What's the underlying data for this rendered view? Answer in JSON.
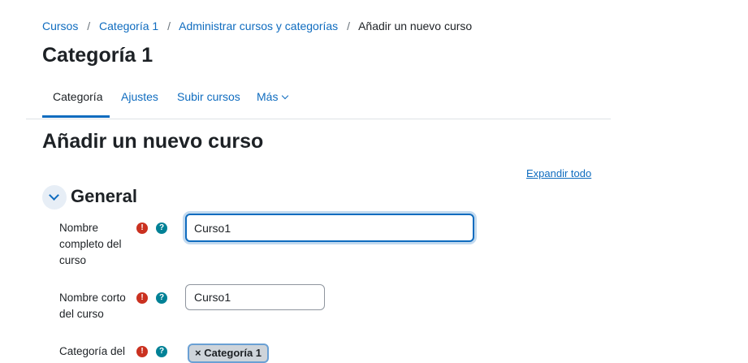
{
  "breadcrumb": {
    "items": [
      "Cursos",
      "Categoría 1",
      "Administrar cursos y categorías"
    ],
    "current": "Añadir un nuevo curso",
    "separator": "/"
  },
  "page_title": "Categoría 1",
  "tabs": [
    {
      "label": "Categoría",
      "active": true
    },
    {
      "label": "Ajustes",
      "active": false
    },
    {
      "label": "Subir cursos",
      "active": false
    },
    {
      "label": "Más",
      "active": false
    }
  ],
  "form_title": "Añadir un nuevo curso",
  "expand_all_label": "Expandir todo",
  "section": {
    "title": "General",
    "icon": "chevron-down-icon"
  },
  "fields": {
    "fullname": {
      "label_lines": [
        "Nombre",
        "completo del",
        "curso"
      ],
      "value": "Curso1"
    },
    "shortname": {
      "label_lines": [
        "Nombre corto",
        "del curso"
      ],
      "value": "Curso1"
    },
    "category": {
      "label_lines": [
        "Categoría del"
      ],
      "chip_remove": "×",
      "chip_label": "Categoría 1"
    }
  },
  "icons": {
    "required": "!",
    "help": "?"
  },
  "colors": {
    "link": "#0f6cbf",
    "required": "#ca3120",
    "help": "#008196"
  }
}
